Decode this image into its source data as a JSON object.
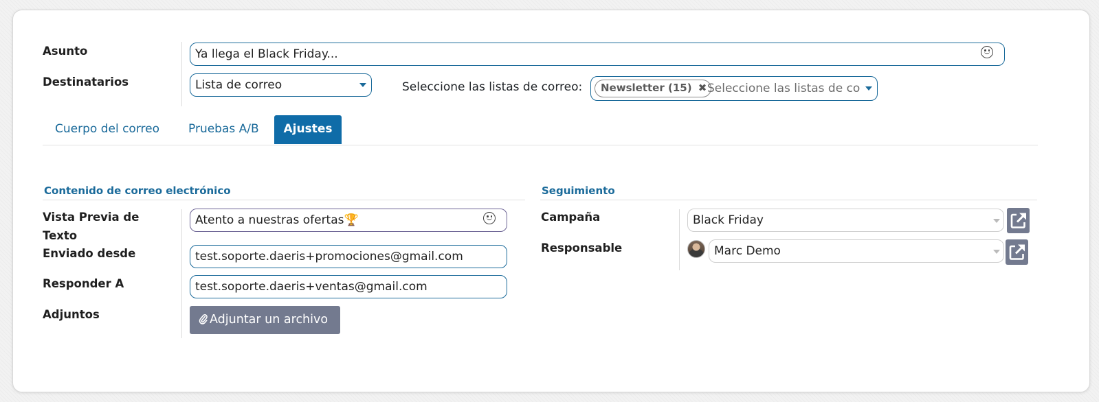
{
  "header_fields": {
    "subject_label": "Asunto",
    "subject_value": "Ya llega el Black Friday...",
    "recipients_label": "Destinatarios",
    "recipients_value": "Lista de correo",
    "mailing_lists_label": "Seleccione las listas de correo:",
    "mailing_list_tag": "Newsletter (15)",
    "mailing_lists_placeholder": "Seleccione las listas de co"
  },
  "tabs": [
    {
      "label": "Cuerpo del correo",
      "active": false
    },
    {
      "label": "Pruebas A/B",
      "active": false
    },
    {
      "label": "Ajustes",
      "active": true
    }
  ],
  "email_content": {
    "section_title": "Contenido de correo electrónico",
    "preview_text_label_line1": "Vista Previa de",
    "preview_text_label_line2": "Texto",
    "preview_text_value": "Atento a nuestras ofertas🏆",
    "sent_from_label": "Enviado desde",
    "sent_from_value": "test.soporte.daeris+promociones@gmail.com",
    "reply_to_label": "Responder A",
    "reply_to_value": "test.soporte.daeris+ventas@gmail.com",
    "attachments_label": "Adjuntos",
    "attach_button_label": "Adjuntar un archivo"
  },
  "tracking": {
    "section_title": "Seguimiento",
    "campaign_label": "Campaña",
    "campaign_value": "Black Friday",
    "responsible_label": "Responsable",
    "responsible_value": "Marc Demo"
  },
  "icons": {
    "emoji": "smiley-icon",
    "paperclip": "paperclip-icon",
    "external_link": "external-link-icon",
    "tag_remove": "close-icon",
    "dropdown": "caret-down-icon"
  },
  "colors": {
    "primary": "#0f6ca8",
    "link": "#1a6a9a",
    "secondary_button": "#737a8f"
  }
}
